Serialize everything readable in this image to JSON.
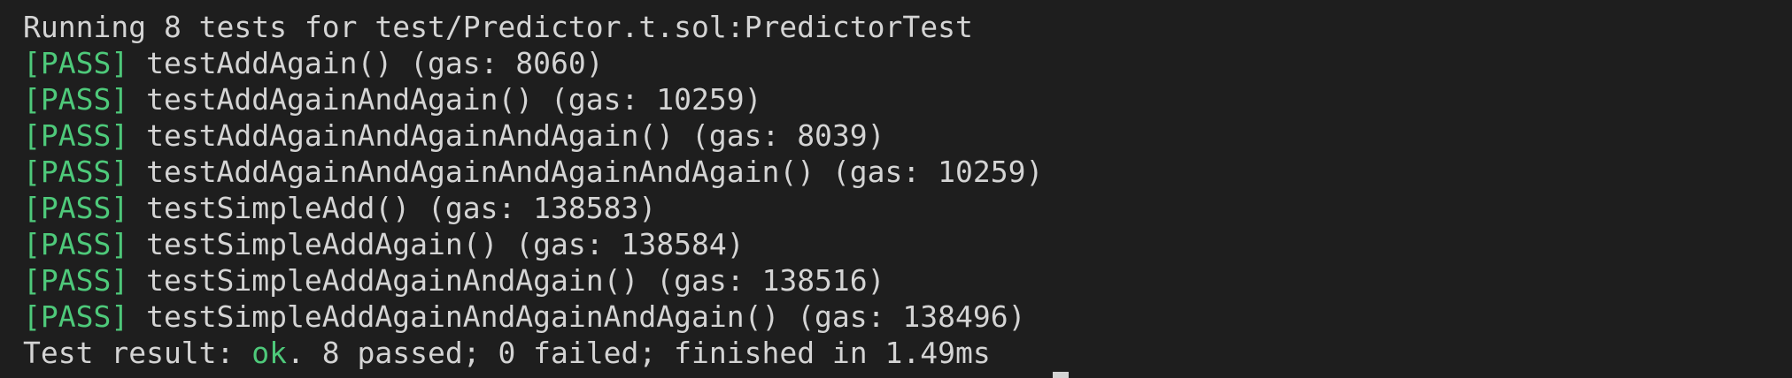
{
  "header": {
    "text": "Running 8 tests for test/Predictor.t.sol:PredictorTest"
  },
  "tests": [
    {
      "status": "[PASS]",
      "text": " testAddAgain() (gas: 8060)"
    },
    {
      "status": "[PASS]",
      "text": " testAddAgainAndAgain() (gas: 10259)"
    },
    {
      "status": "[PASS]",
      "text": " testAddAgainAndAgainAndAgain() (gas: 8039)"
    },
    {
      "status": "[PASS]",
      "text": " testAddAgainAndAgainAndAgainAndAgain() (gas: 10259)"
    },
    {
      "status": "[PASS]",
      "text": " testSimpleAdd() (gas: 138583)"
    },
    {
      "status": "[PASS]",
      "text": " testSimpleAddAgain() (gas: 138584)"
    },
    {
      "status": "[PASS]",
      "text": " testSimpleAddAgainAndAgain() (gas: 138516)"
    },
    {
      "status": "[PASS]",
      "text": " testSimpleAddAgainAndAgainAndAgain() (gas: 138496)"
    }
  ],
  "result": {
    "prefix": "Test result: ",
    "status": "ok",
    "suffix": ". 8 passed; 0 failed; finished in 1.49ms"
  },
  "colors": {
    "background": "#1e1e1e",
    "text": "#d4d4d4",
    "pass": "#4ec97a"
  }
}
